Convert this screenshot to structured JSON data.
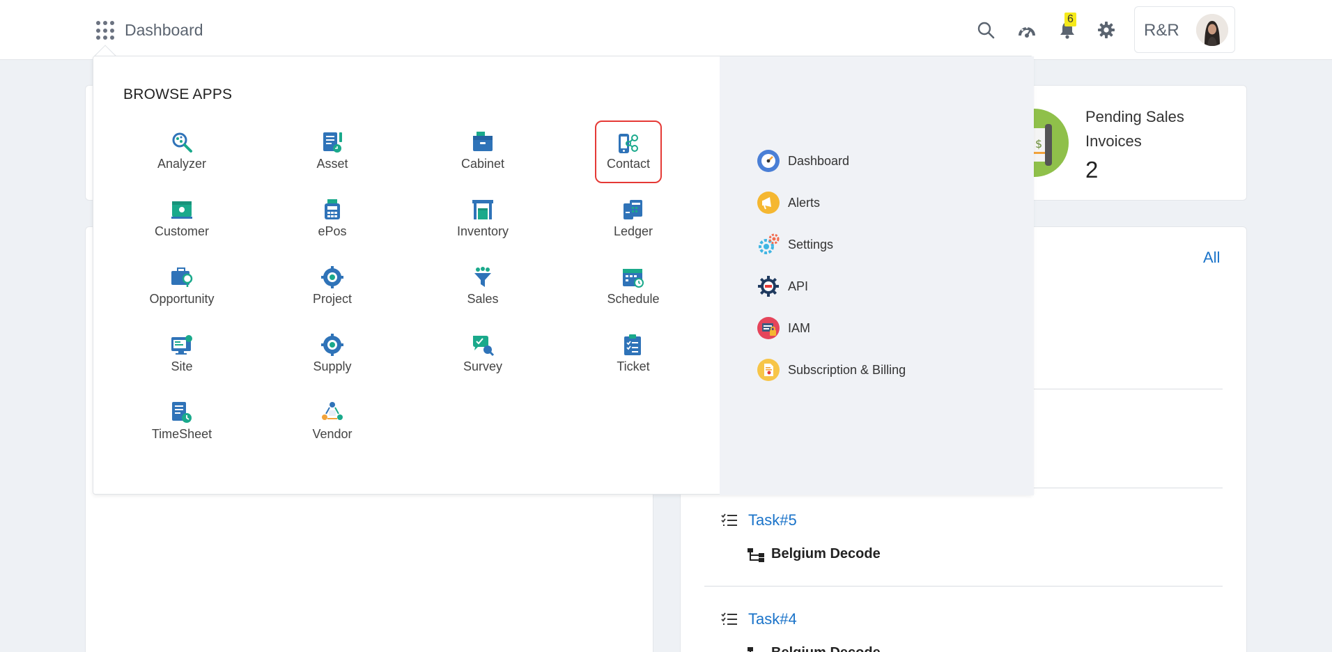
{
  "topbar": {
    "title": "Dashboard",
    "notification_count": "6",
    "user_initials": "R&R"
  },
  "dashboard": {
    "pending_card": {
      "title": "Pending Sales Invoices",
      "value": "2"
    },
    "tasks_card": {
      "all_link": "All",
      "tasks": [
        {
          "name": "Task#5",
          "project": "Belgium Decode"
        },
        {
          "name": "Task#4",
          "project": "Belgium Decode"
        }
      ]
    }
  },
  "browse_apps": {
    "title": "BROWSE APPS",
    "apps": [
      {
        "label": "Analyzer",
        "icon": "analyzer-icon"
      },
      {
        "label": "Asset",
        "icon": "asset-icon"
      },
      {
        "label": "Cabinet",
        "icon": "cabinet-icon"
      },
      {
        "label": "Contact",
        "icon": "contact-icon",
        "selected": true
      },
      {
        "label": "Customer",
        "icon": "customer-icon"
      },
      {
        "label": "ePos",
        "icon": "epos-icon"
      },
      {
        "label": "Inventory",
        "icon": "inventory-icon"
      },
      {
        "label": "Ledger",
        "icon": "ledger-icon"
      },
      {
        "label": "Opportunity",
        "icon": "opportunity-icon"
      },
      {
        "label": "Project",
        "icon": "project-icon"
      },
      {
        "label": "Sales",
        "icon": "sales-icon"
      },
      {
        "label": "Schedule",
        "icon": "schedule-icon"
      },
      {
        "label": "Site",
        "icon": "site-icon"
      },
      {
        "label": "Supply",
        "icon": "supply-icon"
      },
      {
        "label": "Survey",
        "icon": "survey-icon"
      },
      {
        "label": "Ticket",
        "icon": "ticket-icon"
      },
      {
        "label": "TimeSheet",
        "icon": "timesheet-icon"
      },
      {
        "label": "Vendor",
        "icon": "vendor-icon"
      }
    ],
    "quick_links": [
      {
        "label": "Dashboard",
        "icon": "dashboard-gauge-icon"
      },
      {
        "label": "Alerts",
        "icon": "megaphone-icon"
      },
      {
        "label": "Settings",
        "icon": "gears-icon"
      },
      {
        "label": "API",
        "icon": "api-gear-icon"
      },
      {
        "label": "IAM",
        "icon": "iam-lock-icon"
      },
      {
        "label": "Subscription & Billing",
        "icon": "billing-document-icon"
      }
    ]
  },
  "colors": {
    "accent_blue": "#1a73c9",
    "app_icon_teal": "#1aa98b",
    "app_icon_blue": "#2f73b8",
    "selected_outline": "#e53935",
    "badge_yellow": "#f5e91a",
    "right_panel_bg": "#f0f2f6"
  }
}
